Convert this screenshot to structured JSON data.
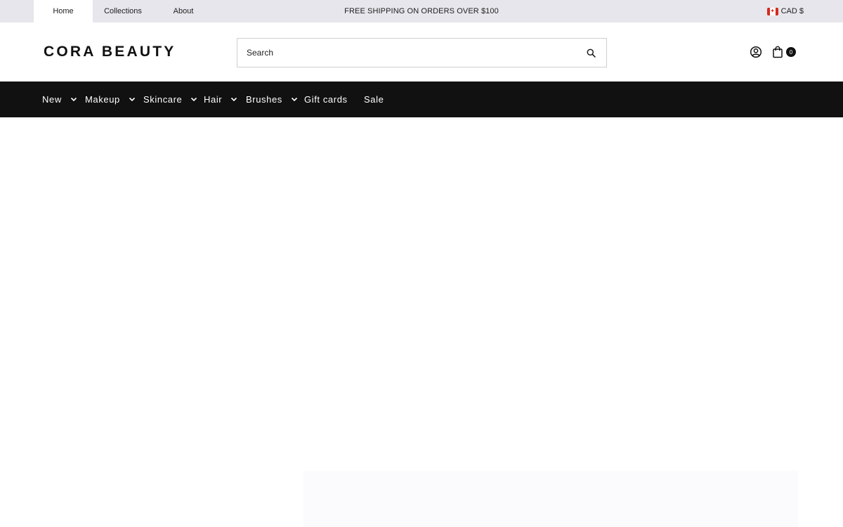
{
  "topbar": {
    "nav": [
      {
        "label": "Home",
        "active": true
      },
      {
        "label": "Collections"
      },
      {
        "label": "About"
      }
    ],
    "promo": "FREE SHIPPING ON ORDERS OVER $100",
    "currency": {
      "label": "CAD $",
      "flag": "canada-flag-icon"
    }
  },
  "header": {
    "logo": "CORA BEAUTY",
    "search": {
      "placeholder": "Search",
      "icon": "search-icon"
    },
    "account_icon": "user-circle-icon",
    "cart": {
      "icon": "shopping-bag-icon",
      "count": "0"
    }
  },
  "main_nav": {
    "items": [
      {
        "label": "New",
        "dropdown": true
      },
      {
        "label": "Makeup",
        "dropdown": true
      },
      {
        "label": "Skincare",
        "dropdown": true
      },
      {
        "label": "Hair",
        "dropdown": true
      },
      {
        "label": "Brushes",
        "dropdown": true
      },
      {
        "label": "Gift cards",
        "dropdown": false
      },
      {
        "label": "Sale",
        "dropdown": false
      }
    ]
  },
  "colors": {
    "topbar_bg": "#e6e6ec",
    "nav_bg": "#111111",
    "nav_text": "#ffffff",
    "page_bg": "#ffffff"
  }
}
